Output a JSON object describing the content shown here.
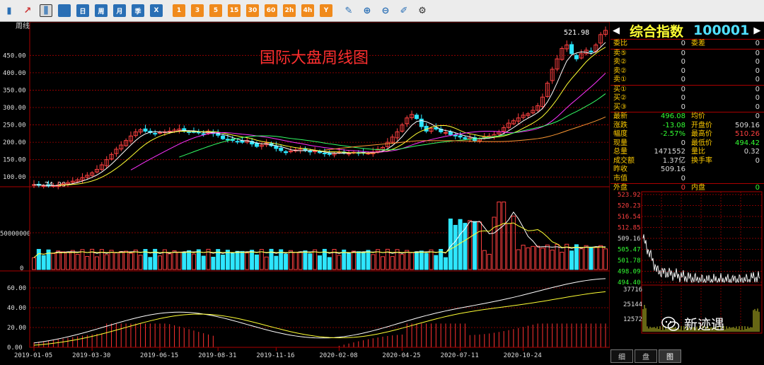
{
  "toolbar": {
    "items": [
      {
        "name": "bar-chart-icon",
        "label": "",
        "kind": "plain"
      },
      {
        "name": "line-chart-icon",
        "label": "",
        "kind": "plain"
      },
      {
        "name": "candlestick-icon",
        "label": "",
        "kind": "sel"
      },
      {
        "name": "calendar-icon",
        "label": "",
        "kind": "blue"
      },
      {
        "name": "period-day-button",
        "label": "日",
        "kind": "blue"
      },
      {
        "name": "period-week-button",
        "label": "周",
        "kind": "blue"
      },
      {
        "name": "period-month-button",
        "label": "月",
        "kind": "blue"
      },
      {
        "name": "period-quarter-button",
        "label": "季",
        "kind": "blue"
      },
      {
        "name": "close-x-button",
        "label": "X",
        "kind": "blue"
      },
      {
        "name": "period-1min-button",
        "label": "1",
        "kind": "orange"
      },
      {
        "name": "period-3min-button",
        "label": "3",
        "kind": "orange"
      },
      {
        "name": "period-5min-button",
        "label": "5",
        "kind": "orange"
      },
      {
        "name": "period-15min-button",
        "label": "15",
        "kind": "orange"
      },
      {
        "name": "period-30min-button",
        "label": "30",
        "kind": "orange"
      },
      {
        "name": "period-60min-button",
        "label": "60",
        "kind": "orange"
      },
      {
        "name": "period-2h-button",
        "label": "2h",
        "kind": "orange"
      },
      {
        "name": "period-4h-button",
        "label": "4h",
        "kind": "orange"
      },
      {
        "name": "period-year-button",
        "label": "Y",
        "kind": "orange"
      },
      {
        "name": "edit-icon",
        "label": "",
        "kind": "plain"
      },
      {
        "name": "zoom-in-icon",
        "label": "",
        "kind": "plain"
      },
      {
        "name": "zoom-out-icon",
        "label": "",
        "kind": "plain"
      },
      {
        "name": "draw-icon",
        "label": "",
        "kind": "plain"
      },
      {
        "name": "gear-icon",
        "label": "",
        "kind": "plain"
      }
    ]
  },
  "chart": {
    "period_label": "周线",
    "overlay_title": "国际大盘周线图",
    "last_price_label": "521.98",
    "low_marker_label": "74.09",
    "vol_tick_label": "50000000",
    "vol_zero_label": "0",
    "x_ticks": [
      "2019-01-05",
      "2019-03-30",
      "2019-06-15",
      "2019-08-31",
      "2019-11-16",
      "2020-02-08",
      "2020-04-25",
      "2020-07-11",
      "2020-10-24"
    ],
    "price_ticks": [
      "450.00",
      "400.00",
      "350.00",
      "300.00",
      "250.00",
      "200.00",
      "150.00",
      "100.00"
    ],
    "macd_ticks": [
      "60.00",
      "40.00",
      "20.00",
      "0.00"
    ]
  },
  "chart_data": {
    "type": "candlestick",
    "title": "国际大盘周线图",
    "period": "weekly",
    "price_ylim": [
      74,
      530
    ],
    "price_ticks": [
      100,
      150,
      200,
      250,
      300,
      350,
      400,
      450
    ],
    "x_ticks": [
      "2019-01-05",
      "2019-03-30",
      "2019-06-15",
      "2019-08-31",
      "2019-11-16",
      "2020-02-08",
      "2020-04-25",
      "2020-07-11",
      "2020-10-24"
    ],
    "close": [
      78,
      76,
      75,
      74,
      75,
      77,
      80,
      84,
      88,
      92,
      98,
      105,
      112,
      122,
      135,
      150,
      165,
      180,
      192,
      205,
      218,
      230,
      236,
      232,
      228,
      225,
      228,
      230,
      232,
      235,
      238,
      233,
      228,
      230,
      227,
      224,
      232,
      225,
      220,
      210,
      208,
      205,
      202,
      200,
      205,
      195,
      188,
      192,
      198,
      190,
      182,
      176,
      170,
      175,
      178,
      180,
      176,
      172,
      175,
      170,
      167,
      165,
      168,
      172,
      170,
      168,
      171,
      170,
      169,
      168,
      172,
      180,
      185,
      200,
      215,
      230,
      250,
      270,
      280,
      268,
      245,
      232,
      240,
      238,
      230,
      228,
      222,
      218,
      215,
      210,
      212,
      205,
      210,
      215,
      218,
      222,
      230,
      242,
      255,
      262,
      270,
      278,
      282,
      292,
      305,
      330,
      370,
      410,
      440,
      470,
      480,
      455,
      440,
      455,
      465,
      460,
      480,
      510,
      522
    ],
    "volume_scale": "50000000",
    "macd_ylim": [
      0,
      70
    ],
    "macd_ticks": [
      0,
      20,
      40,
      60
    ],
    "price_colors": {
      "up": "#ff4040",
      "down": "#2ee6ff",
      "ma5": "#ffffff",
      "ma10": "#ffff33",
      "ma20": "#ff33ff",
      "ma30": "#33ff66",
      "ma60": "#ff9933"
    }
  },
  "quote": {
    "title": "综合指数",
    "code": "100001",
    "rows": [
      {
        "l1": "委比",
        "v1": "0",
        "l2": "委差",
        "v2": "0",
        "sep": true
      },
      {
        "l1": "卖⑤",
        "v1": "0",
        "l2": "",
        "v2": "0"
      },
      {
        "l1": "卖②",
        "v1": "0",
        "l2": "",
        "v2": "0"
      },
      {
        "l1": "卖②",
        "v1": "0",
        "l2": "",
        "v2": "0"
      },
      {
        "l1": "卖①",
        "v1": "0",
        "l2": "",
        "v2": "0",
        "sep": true
      },
      {
        "l1": "买①",
        "v1": "0",
        "l2": "",
        "v2": "0"
      },
      {
        "l1": "买②",
        "v1": "0",
        "l2": "",
        "v2": "0"
      },
      {
        "l1": "买③",
        "v1": "0",
        "l2": "",
        "v2": "0",
        "sep": true
      },
      {
        "l1": "最新",
        "v1": "496.08",
        "l2": "均价",
        "v2": "0",
        "c1": "#33ff33"
      },
      {
        "l1": "涨跌",
        "v1": "-13.08",
        "l2": "开盘价",
        "v2": "509.16",
        "c1": "#33ff33"
      },
      {
        "l1": "幅度",
        "v1": "-2.57%",
        "l2": "最高价",
        "v2": "510.26",
        "c1": "#33ff33",
        "c2": "#ff4040"
      },
      {
        "l1": "现量",
        "v1": "0",
        "l2": "最低价",
        "v2": "494.42",
        "c2": "#33ff33"
      },
      {
        "l1": "总量",
        "v1": "1471552",
        "l2": "量比",
        "v2": "0.32"
      },
      {
        "l1": "成交额",
        "v1": "1.37亿",
        "l2": "换手率",
        "v2": "0"
      },
      {
        "l1": "昨收",
        "v1": "509.16",
        "l2": "",
        "v2": ""
      },
      {
        "l1": "市值",
        "v1": "0",
        "l2": "",
        "v2": "",
        "sep": true
      },
      {
        "l1": "外盘",
        "v1": "0",
        "l2": "内盘",
        "v2": "0",
        "c1": "#ff4040",
        "c2": "#33ff33"
      }
    ]
  },
  "intraday": {
    "price_labels": [
      "523.92",
      "520.23",
      "516.54",
      "512.85",
      "509.16",
      "505.47",
      "501.78",
      "498.09",
      "494.40"
    ],
    "vol_labels": [
      "37716",
      "25144",
      "12572"
    ]
  },
  "tabs": [
    "细",
    "盘",
    "图"
  ],
  "watermark": {
    "text": "新迹遇"
  }
}
